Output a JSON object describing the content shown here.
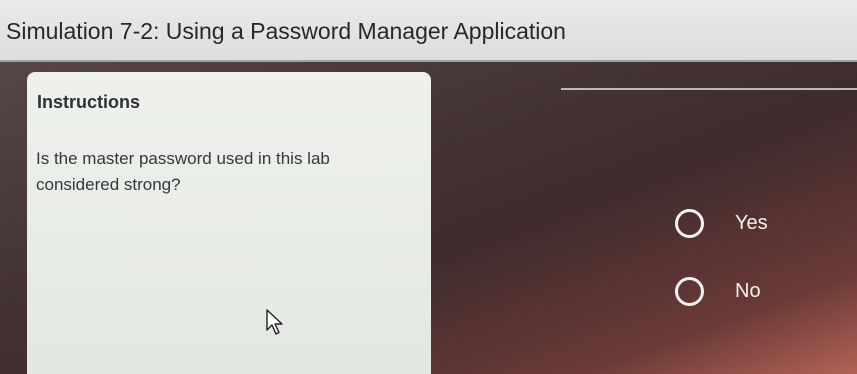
{
  "header": {
    "title": "Simulation 7-2: Using a Password Manager Application"
  },
  "instructions": {
    "heading": "Instructions",
    "question": "Is the master password used in this lab considered strong?"
  },
  "answers": {
    "options": [
      {
        "label": "Yes",
        "selected": false
      },
      {
        "label": "No",
        "selected": false
      }
    ]
  },
  "colors": {
    "title_bar_bg": "#e9ebe8",
    "panel_bg": "#eef1ec",
    "background_dark": "#3e2b2c",
    "radio_outline": "#f2f2f2"
  },
  "icons": {
    "cursor": "mouse-pointer-icon"
  }
}
